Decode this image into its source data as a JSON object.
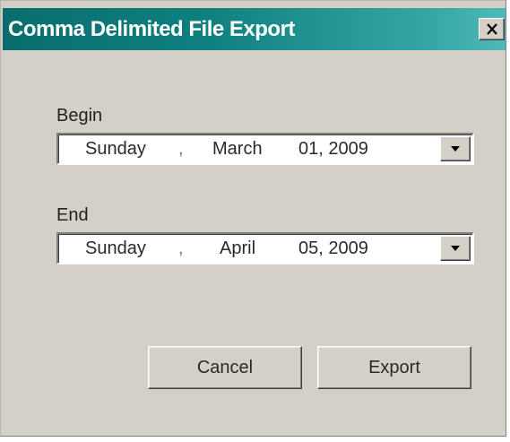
{
  "window": {
    "title": "Comma Delimited File Export",
    "close_icon": "close-icon"
  },
  "begin": {
    "label": "Begin",
    "weekday": "Sunday",
    "separator": ",",
    "month": "March",
    "day_year": "01, 2009"
  },
  "end": {
    "label": "End",
    "weekday": "Sunday",
    "separator": ",",
    "month": "April",
    "day_year": "05, 2009"
  },
  "buttons": {
    "cancel": "Cancel",
    "export": "Export"
  },
  "colors": {
    "title_bar_start": "#0a6d6d",
    "title_bar_end": "#4fb9b9",
    "dialog_face": "#d4d0c8"
  }
}
